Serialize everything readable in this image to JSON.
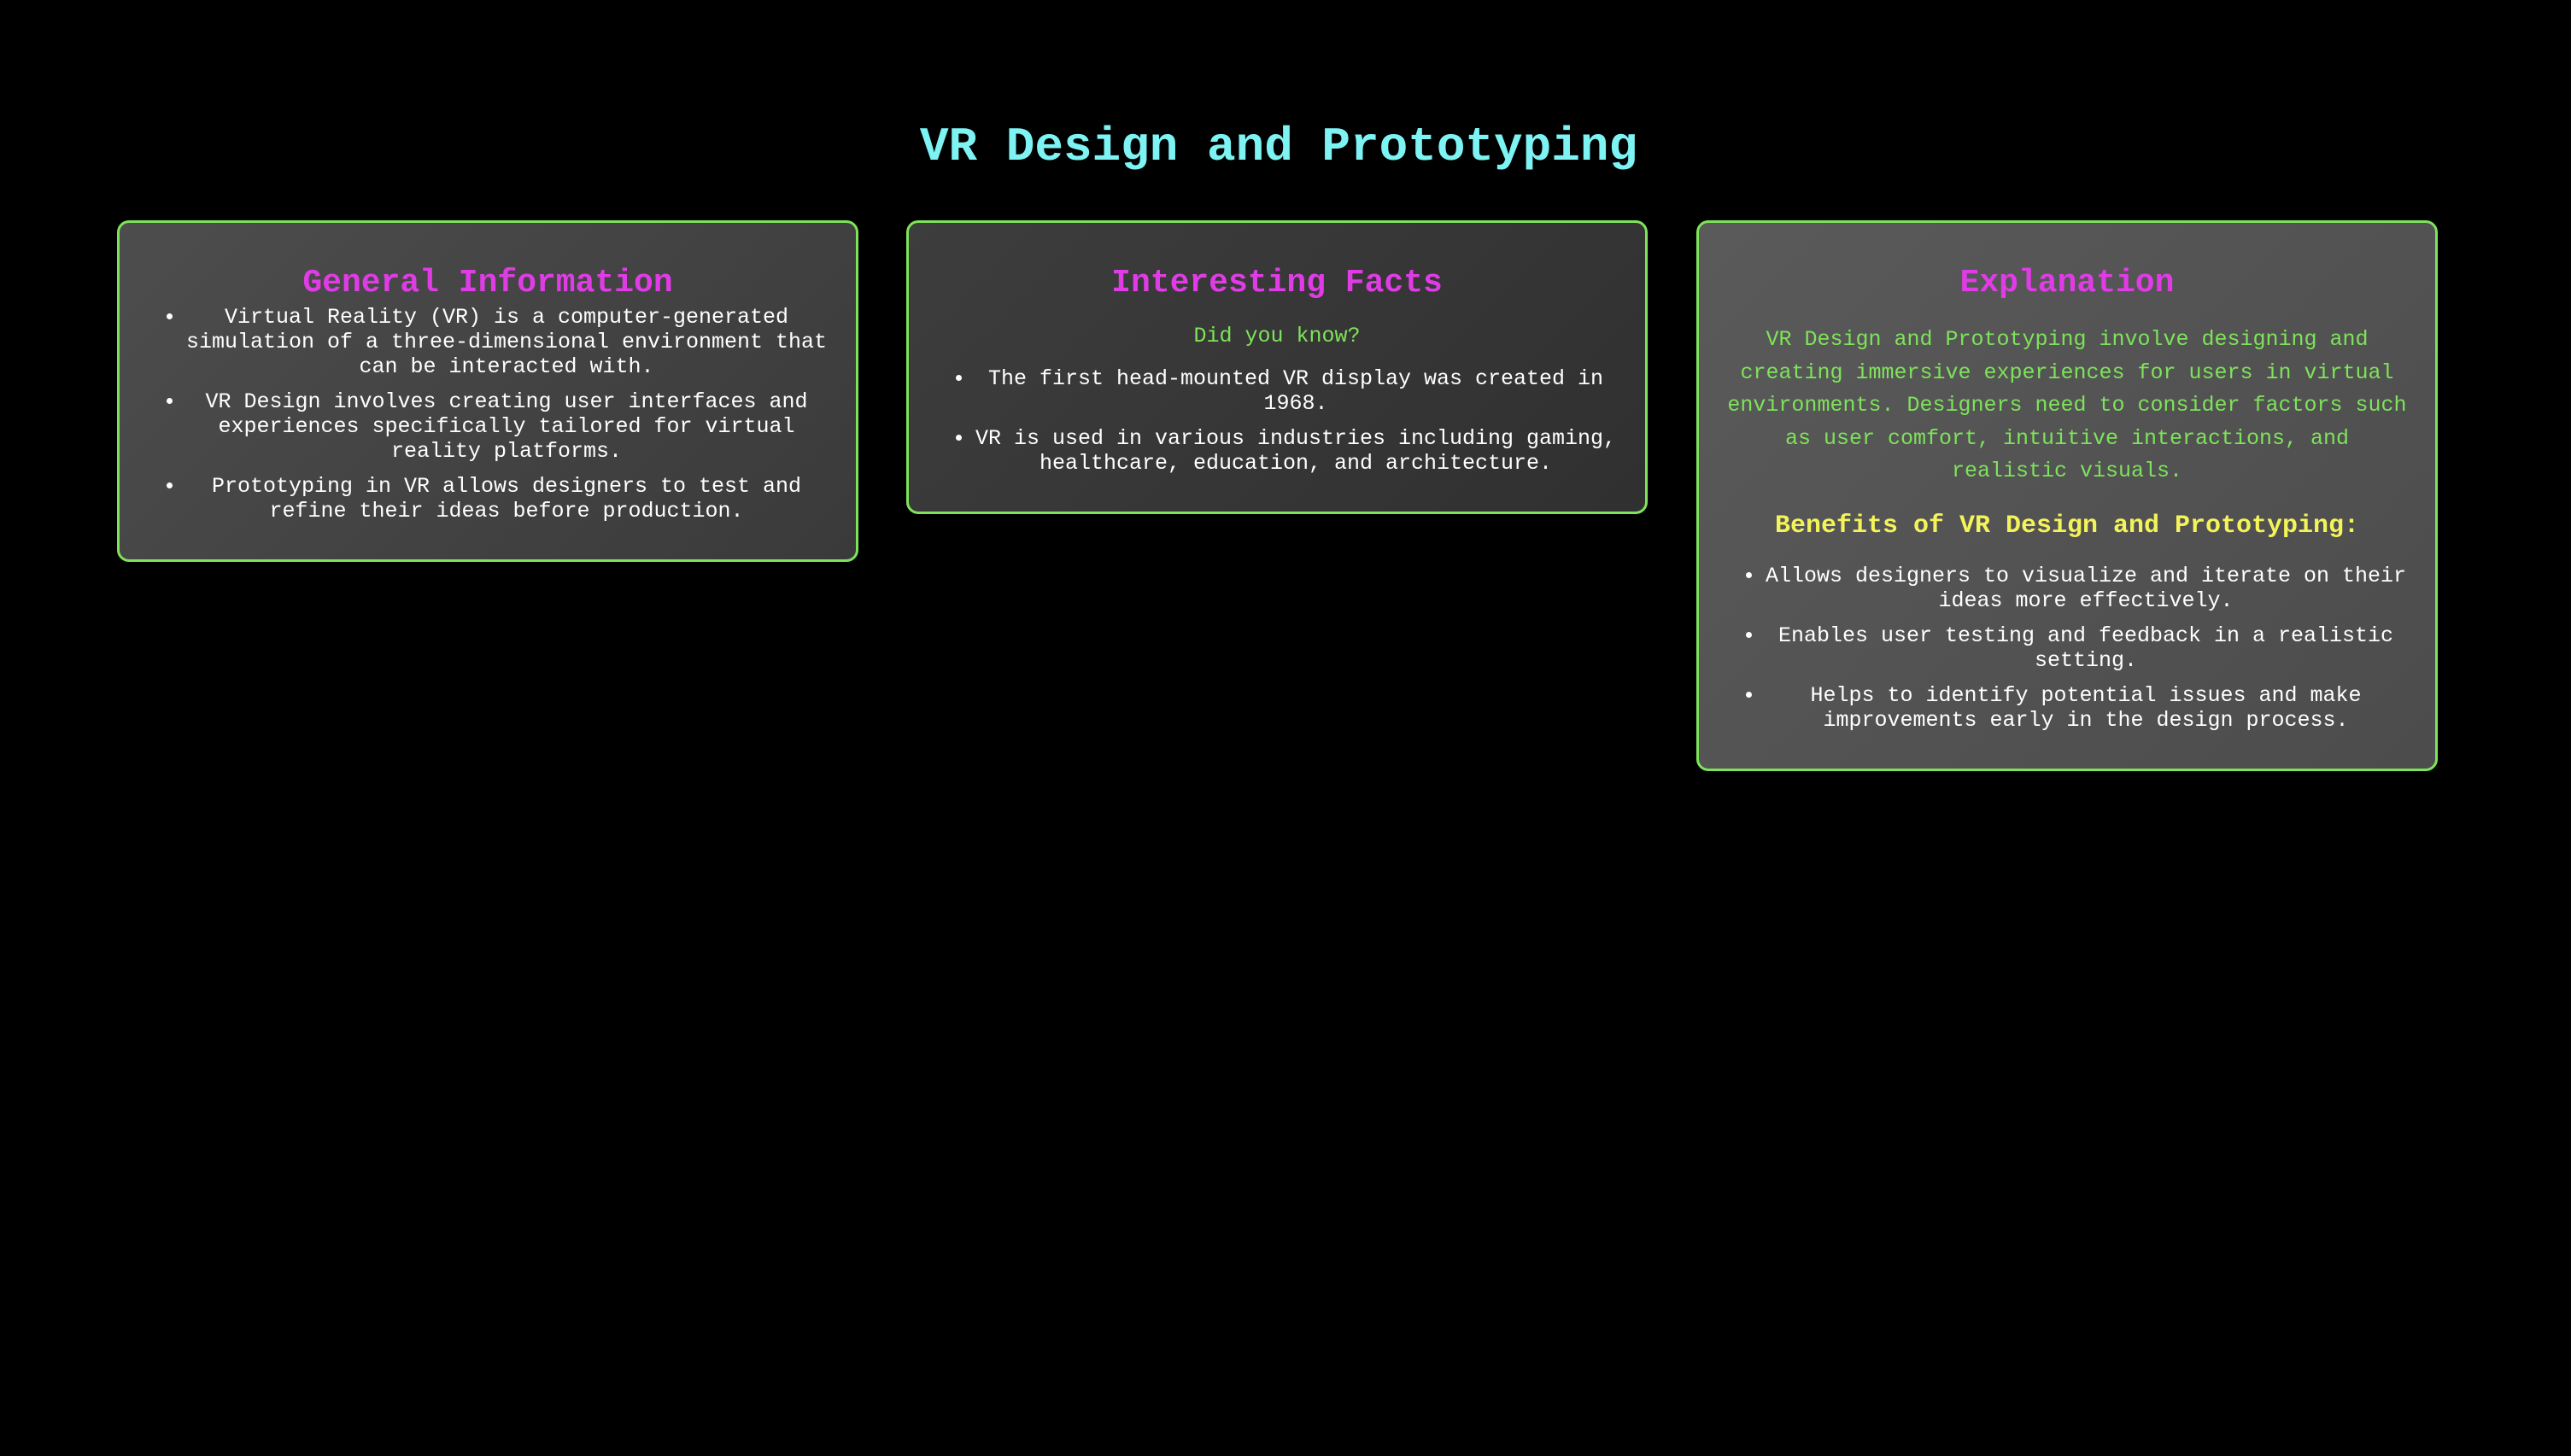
{
  "page": {
    "title": "VR Design and Prototyping"
  },
  "general": {
    "heading": "General Information",
    "items": [
      "Virtual Reality (VR) is a computer-generated simulation of a three-dimensional environment that can be interacted with.",
      "VR Design involves creating user interfaces and experiences specifically tailored for virtual reality platforms.",
      "Prototyping in VR allows designers to test and refine their ideas before production."
    ]
  },
  "facts": {
    "heading": "Interesting Facts",
    "subtitle": "Did you know?",
    "items": [
      "The first head-mounted VR display was created in 1968.",
      "VR is used in various industries including gaming, healthcare, education, and architecture."
    ]
  },
  "explanation": {
    "heading": "Explanation",
    "text": "VR Design and Prototyping involve designing and creating immersive experiences for users in virtual environments. Designers need to consider factors such as user comfort, intuitive interactions, and realistic visuals.",
    "benefits_heading": "Benefits of VR Design and Prototyping:",
    "benefits": [
      "Allows designers to visualize and iterate on their ideas more effectively.",
      "Enables user testing and feedback in a realistic setting.",
      "Helps to identify potential issues and make improvements early in the design process."
    ]
  },
  "colors": {
    "background": "#000000",
    "title": "#7df3f3",
    "card_heading": "#e03ce6",
    "card_border": "#7ee35a",
    "accent_text": "#7ee35a",
    "benefits_heading": "#f3f35a",
    "body_text": "#ffffff"
  }
}
